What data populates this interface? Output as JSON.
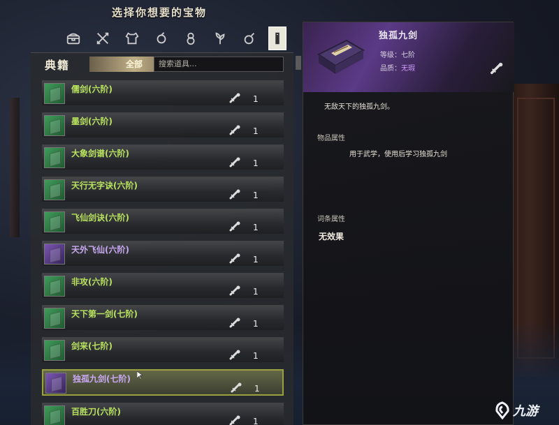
{
  "title": "选择你想要的宝物",
  "tabs": [
    {
      "icon": "chest-icon"
    },
    {
      "icon": "weapons-icon"
    },
    {
      "icon": "armor-icon"
    },
    {
      "icon": "accessory-icon"
    },
    {
      "icon": "gourd-icon"
    },
    {
      "icon": "herb-icon"
    },
    {
      "icon": "pill-icon"
    },
    {
      "icon": "book-icon",
      "active": true
    }
  ],
  "left_panel": {
    "heading": "典籍",
    "filter_label": "全部",
    "search_placeholder": "搜索道具..."
  },
  "items": [
    {
      "name": "儒剑(六阶)",
      "count": "1",
      "color": "green"
    },
    {
      "name": "墨剑(六阶)",
      "count": "1",
      "color": "green"
    },
    {
      "name": "大象剑谱(六阶)",
      "count": "1",
      "color": "green"
    },
    {
      "name": "天行无字诀(六阶)",
      "count": "1",
      "color": "green"
    },
    {
      "name": "飞仙剑诀(六阶)",
      "count": "1",
      "color": "green"
    },
    {
      "name": "天外飞仙(六阶)",
      "count": "1",
      "color": "purple"
    },
    {
      "name": "非攻(六阶)",
      "count": "1",
      "color": "green"
    },
    {
      "name": "天下第一剑(七阶)",
      "count": "1",
      "color": "green"
    },
    {
      "name": "剑来(七阶)",
      "count": "1",
      "color": "green"
    },
    {
      "name": "独孤九剑(七阶)",
      "count": "1",
      "color": "purple",
      "selected": true
    },
    {
      "name": "百胜刀(六阶)",
      "count": "1",
      "color": "green"
    }
  ],
  "detail": {
    "name": "独孤九剑",
    "grade_label": "等级：",
    "grade_value": "七阶",
    "quality_label": "品质：",
    "quality_value": "无瑕",
    "description": "无敌天下的独孤九剑。",
    "section1_title": "物品属性",
    "section1_text": "用于武学，使用后学习独孤九剑",
    "section2_title": "词条属性",
    "section2_text": "无效果"
  },
  "watermark": "九游",
  "colors": {
    "green_name": "#b8e25e",
    "purple_name": "#c9a8f2",
    "selected_border": "#9aa13e",
    "quality_purple": "#d59cff"
  }
}
